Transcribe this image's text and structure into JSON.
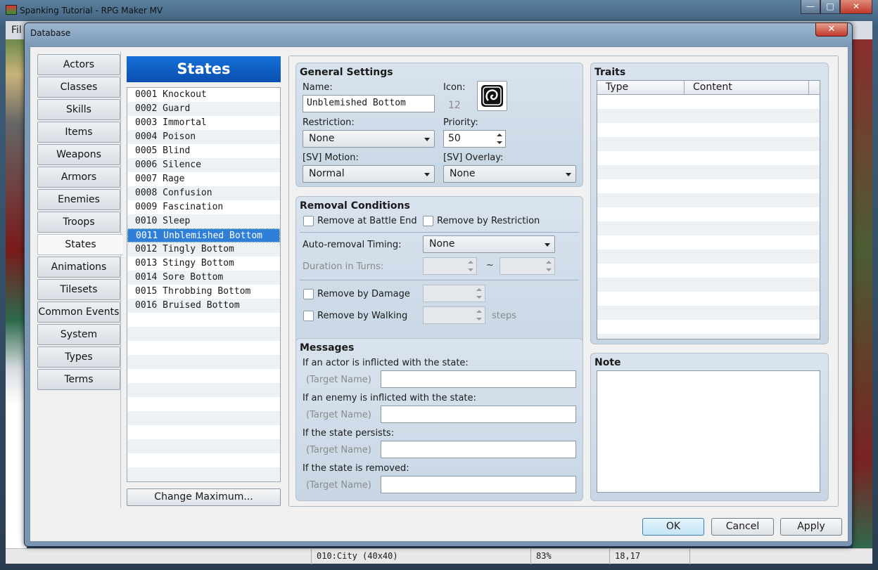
{
  "main_window": {
    "title": "Spanking Tutorial - RPG Maker MV",
    "menu_partial": "Fil",
    "buttons": {
      "minimize": "—",
      "maximize": "□",
      "close": "✕"
    },
    "statusbar": {
      "map": "010:City (40x40)",
      "zoom": "83%",
      "coords": "18,17"
    }
  },
  "dialog": {
    "title": "Database",
    "close_label": "✕",
    "categories": [
      "Actors",
      "Classes",
      "Skills",
      "Items",
      "Weapons",
      "Armors",
      "Enemies",
      "Troops",
      "States",
      "Animations",
      "Tilesets",
      "Common Events",
      "System",
      "Types",
      "Terms"
    ],
    "selected_category": "States",
    "buttons": {
      "ok": "OK",
      "cancel": "Cancel",
      "apply": "Apply"
    }
  },
  "states": {
    "heading": "States",
    "items": [
      "0001 Knockout",
      "0002 Guard",
      "0003 Immortal",
      "0004 Poison",
      "0005 Blind",
      "0006 Silence",
      "0007 Rage",
      "0008 Confusion",
      "0009 Fascination",
      "0010 Sleep",
      "0011 Unblemished Bottom",
      "0012 Tingly Bottom",
      "0013 Stingy Bottom",
      "0014 Sore Bottom",
      "0015 Throbbing Bottom",
      "0016 Bruised Bottom"
    ],
    "selected_index": 10,
    "change_max": "Change Maximum..."
  },
  "general": {
    "title": "General Settings",
    "name_label": "Name:",
    "name_value": "Unblemished Bottom",
    "icon_label": "Icon:",
    "icon_index": "12",
    "restriction_label": "Restriction:",
    "restriction_value": "None",
    "priority_label": "Priority:",
    "priority_value": "50",
    "motion_label": "[SV] Motion:",
    "motion_value": "Normal",
    "overlay_label": "[SV] Overlay:",
    "overlay_value": "None"
  },
  "removal": {
    "title": "Removal Conditions",
    "battle_end": "Remove at Battle End",
    "by_restriction": "Remove by Restriction",
    "timing_label": "Auto-removal Timing:",
    "timing_value": "None",
    "duration_label": "Duration in Turns:",
    "tilde": "~",
    "by_damage": "Remove by Damage",
    "by_walking": "Remove by Walking",
    "steps": "steps"
  },
  "messages": {
    "title": "Messages",
    "target_placeholder": "(Target Name)",
    "prompts": [
      "If an actor is inflicted with the state:",
      "If an enemy is inflicted with the state:",
      "If the state persists:",
      "If the state is removed:"
    ]
  },
  "traits": {
    "title": "Traits",
    "col_type": "Type",
    "col_content": "Content"
  },
  "note": {
    "title": "Note"
  }
}
